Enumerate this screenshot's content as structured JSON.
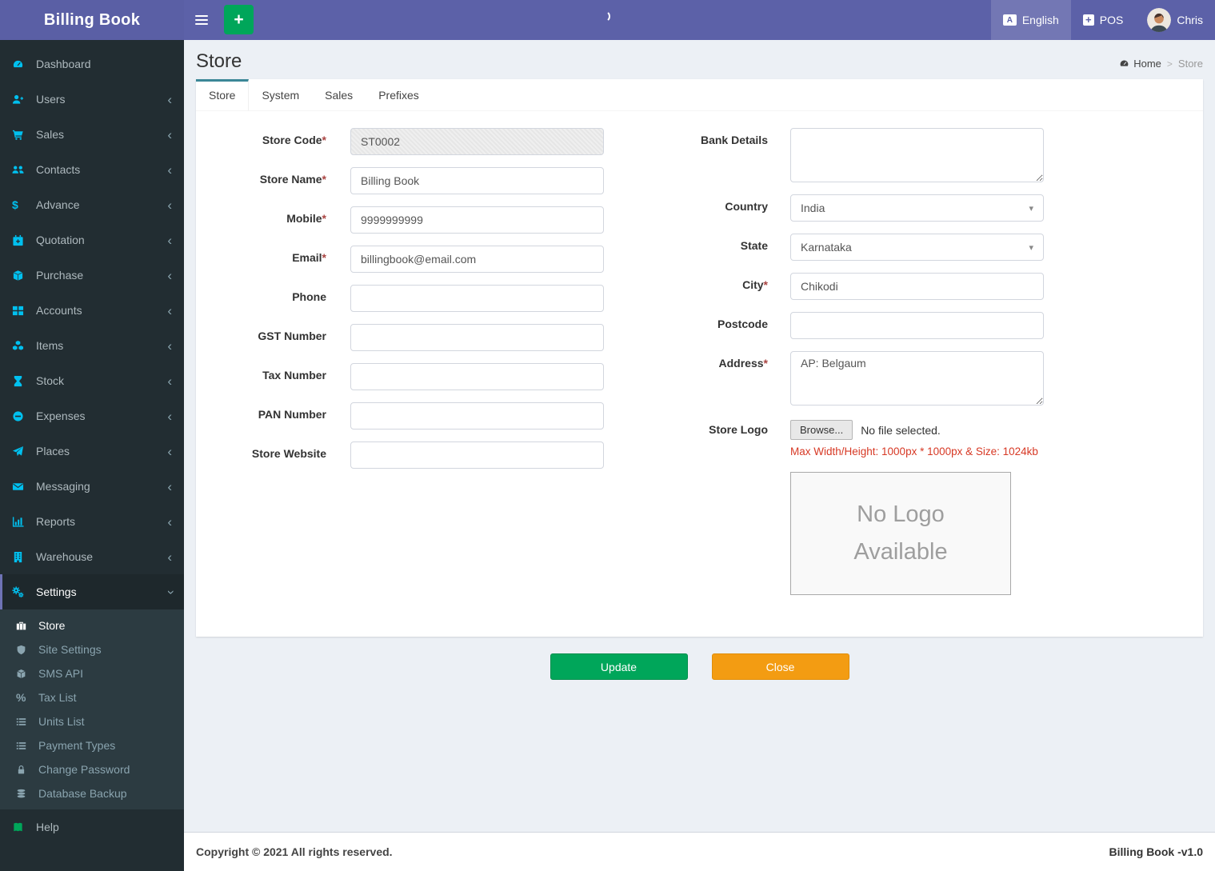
{
  "app": {
    "brand": "Billing Book",
    "copyright": "Copyright © 2021 All rights reserved.",
    "version": "Billing Book -v1.0"
  },
  "navbar": {
    "add_button_glyph": "+",
    "language_label": "English",
    "language_icon_glyph": "A",
    "pos_label": "POS",
    "pos_icon_glyph": "+",
    "user_name": "Chris"
  },
  "page": {
    "title": "Store",
    "breadcrumb": {
      "home": "Home",
      "separator": ">",
      "current": "Store"
    }
  },
  "tabs": [
    {
      "label": "Store",
      "active": true
    },
    {
      "label": "System",
      "active": false
    },
    {
      "label": "Sales",
      "active": false
    },
    {
      "label": "Prefixes",
      "active": false
    }
  ],
  "sidebar": {
    "items": [
      {
        "label": "Dashboard",
        "icon": "gauge",
        "chevron": ""
      },
      {
        "label": "Users",
        "icon": "user-plus",
        "chevron": "left"
      },
      {
        "label": "Sales",
        "icon": "cart",
        "chevron": "left"
      },
      {
        "label": "Contacts",
        "icon": "users",
        "chevron": "left"
      },
      {
        "label": "Advance",
        "icon": "dollar",
        "chevron": "left"
      },
      {
        "label": "Quotation",
        "icon": "calendar-plus",
        "chevron": "left"
      },
      {
        "label": "Purchase",
        "icon": "cube",
        "chevron": "left"
      },
      {
        "label": "Accounts",
        "icon": "grid",
        "chevron": "left"
      },
      {
        "label": "Items",
        "icon": "cubes",
        "chevron": "left"
      },
      {
        "label": "Stock",
        "icon": "hourglass",
        "chevron": "left"
      },
      {
        "label": "Expenses",
        "icon": "minus-circle",
        "chevron": "left"
      },
      {
        "label": "Places",
        "icon": "paper-plane",
        "chevron": "left"
      },
      {
        "label": "Messaging",
        "icon": "envelope",
        "chevron": "left"
      },
      {
        "label": "Reports",
        "icon": "bar-chart",
        "chevron": "left"
      },
      {
        "label": "Warehouse",
        "icon": "building",
        "chevron": "left"
      },
      {
        "label": "Settings",
        "icon": "gears",
        "chevron": "down",
        "active": true,
        "children": [
          {
            "label": "Store",
            "icon": "briefcase",
            "active": true
          },
          {
            "label": "Site Settings",
            "icon": "shield"
          },
          {
            "label": "SMS API",
            "icon": "cube"
          },
          {
            "label": "Tax List",
            "icon": "percent"
          },
          {
            "label": "Units List",
            "icon": "list"
          },
          {
            "label": "Payment Types",
            "icon": "list"
          },
          {
            "label": "Change Password",
            "icon": "lock"
          },
          {
            "label": "Database Backup",
            "icon": "database"
          }
        ]
      },
      {
        "label": "Help",
        "icon": "book",
        "icon_class": "help-icon",
        "chevron": ""
      }
    ]
  },
  "form": {
    "left_fields": [
      {
        "label": "Store Code",
        "mark": "*",
        "value": "ST0002",
        "disabled": true
      },
      {
        "label": "Store Name",
        "mark": "*",
        "value": "Billing Book"
      },
      {
        "label": "Mobile",
        "mark": "*",
        "value": "9999999999"
      },
      {
        "label": "Email",
        "mark": "*",
        "value": "billingbook@email.com"
      },
      {
        "label": "Phone",
        "mark": "",
        "value": ""
      },
      {
        "label": "GST Number",
        "mark": "",
        "value": ""
      },
      {
        "label": "Tax Number",
        "mark": "",
        "value": ""
      },
      {
        "label": "PAN Number",
        "mark": "",
        "value": ""
      },
      {
        "label": "Store Website",
        "mark": "",
        "value": ""
      }
    ],
    "bank_details": {
      "label": "Bank Details",
      "mark": "",
      "value": ""
    },
    "country": {
      "label": "Country",
      "mark": "",
      "value": "India"
    },
    "state": {
      "label": "State",
      "mark": "",
      "value": "Karnataka"
    },
    "city": {
      "label": "City",
      "mark": "*",
      "value": "Chikodi"
    },
    "postcode": {
      "label": "Postcode",
      "mark": "",
      "value": ""
    },
    "address": {
      "label": "Address",
      "mark": "*",
      "value": "AP: Belgaum"
    },
    "store_logo": {
      "label": "Store Logo",
      "mark": "",
      "browse_label": "Browse...",
      "file_status": "No file selected.",
      "hint": "Max Width/Height: 1000px * 1000px & Size: 1024kb",
      "placeholder_text": "No Logo Available"
    }
  },
  "actions": {
    "update_label": "Update",
    "close_label": "Close"
  },
  "colors": {
    "navbar_purple": "#5c61a8",
    "sidebar_dark": "#222d32",
    "submenu_dark": "#2c3b41",
    "icon_cyan": "#00c0ef",
    "active_tab_teal": "#3b8797",
    "success_green": "#00a65a",
    "warning_orange": "#f39c12",
    "danger_red": "#d73925",
    "content_bg": "#ecf0f5"
  }
}
